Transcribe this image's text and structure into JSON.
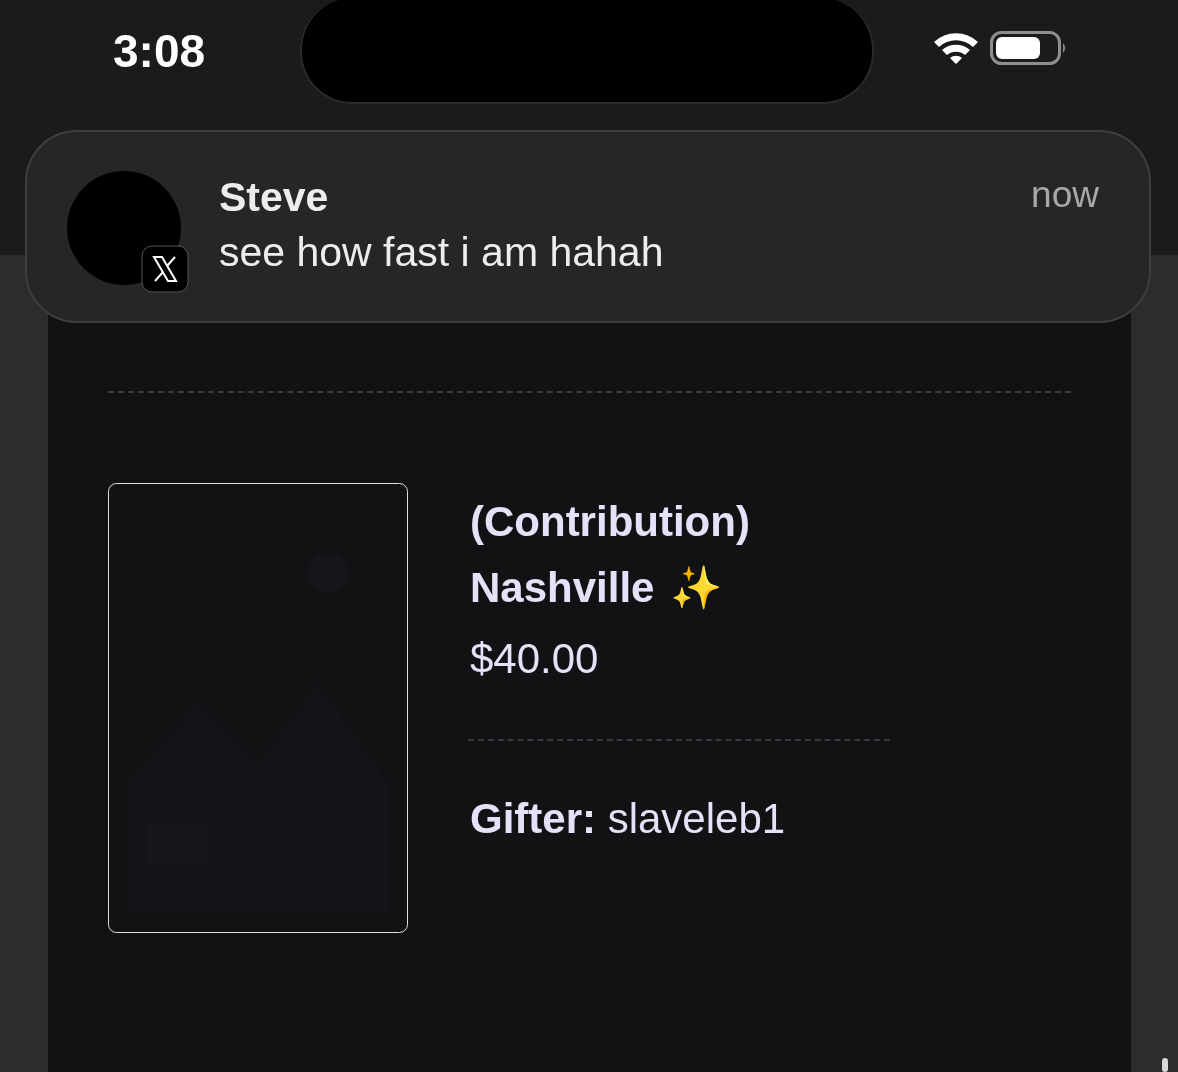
{
  "status_bar": {
    "time": "3:08"
  },
  "notification": {
    "sender": "Steve",
    "message": "see how fast i am hahah",
    "time": "now"
  },
  "item": {
    "title": "(Contribution) Nashville",
    "emoji": "✨",
    "price": "$40.00",
    "gifter": "**Gifter:** slaveleb1"
  }
}
